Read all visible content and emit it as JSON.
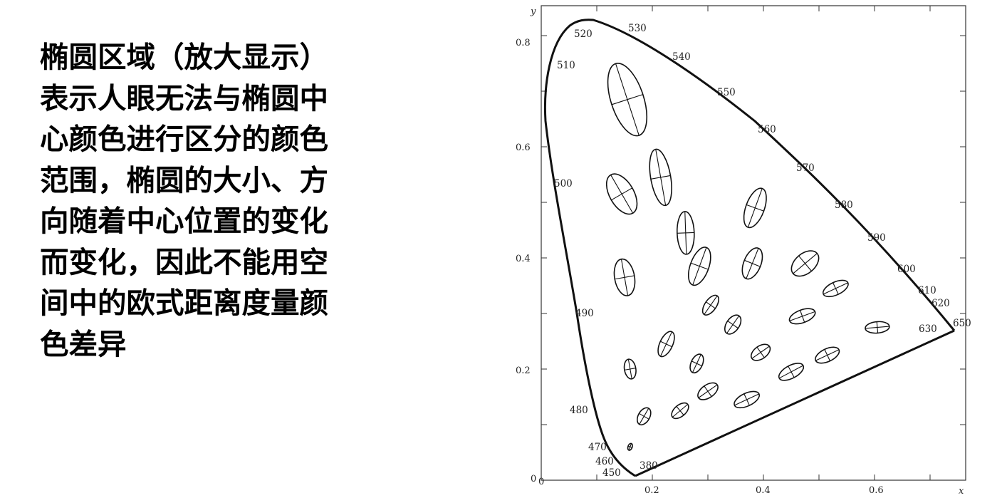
{
  "description_lines": [
    "椭圆区域（放大显示）",
    "表示人眼无法与椭圆中",
    "心颜色进行区分的颜色",
    "范围，椭圆的大小、方",
    "向随着中心位置的变化",
    "而变化，因此不能用空",
    "间中的欧式距离度量颜",
    "色差异"
  ],
  "chart": {
    "x_axis_label": "x",
    "y_axis_label": "y",
    "x_ticks": [
      "0",
      "0.2",
      "0.4",
      "0.6"
    ],
    "y_ticks": [
      "0",
      "0.2",
      "0.4",
      "0.6",
      "0.8"
    ],
    "wavelength_labels": [
      "380",
      "450",
      "460",
      "470",
      "480",
      "490",
      "500",
      "510",
      "520",
      "530",
      "540",
      "550",
      "560",
      "570",
      "580",
      "590",
      "600",
      "610",
      "620",
      "630",
      "650"
    ]
  },
  "chart_data": {
    "type": "scatter",
    "xlabel": "x",
    "ylabel": "y",
    "xlim": [
      0,
      0.75
    ],
    "ylim": [
      0,
      0.85
    ],
    "series": [
      {
        "name": "",
        "values": [
          {
            "x": 0.155,
            "y": 0.685
          },
          {
            "x": 0.215,
            "y": 0.545
          },
          {
            "x": 0.145,
            "y": 0.515
          },
          {
            "x": 0.26,
            "y": 0.445
          },
          {
            "x": 0.285,
            "y": 0.385
          },
          {
            "x": 0.385,
            "y": 0.49
          },
          {
            "x": 0.38,
            "y": 0.39
          },
          {
            "x": 0.475,
            "y": 0.39
          },
          {
            "x": 0.15,
            "y": 0.365
          },
          {
            "x": 0.53,
            "y": 0.345
          },
          {
            "x": 0.305,
            "y": 0.315
          },
          {
            "x": 0.345,
            "y": 0.28
          },
          {
            "x": 0.47,
            "y": 0.295
          },
          {
            "x": 0.605,
            "y": 0.275
          },
          {
            "x": 0.225,
            "y": 0.245
          },
          {
            "x": 0.28,
            "y": 0.21
          },
          {
            "x": 0.395,
            "y": 0.23
          },
          {
            "x": 0.515,
            "y": 0.225
          },
          {
            "x": 0.16,
            "y": 0.2
          },
          {
            "x": 0.45,
            "y": 0.195
          },
          {
            "x": 0.3,
            "y": 0.16
          },
          {
            "x": 0.37,
            "y": 0.145
          },
          {
            "x": 0.25,
            "y": 0.125
          },
          {
            "x": 0.185,
            "y": 0.115
          },
          {
            "x": 0.16,
            "y": 0.06
          }
        ]
      }
    ]
  }
}
